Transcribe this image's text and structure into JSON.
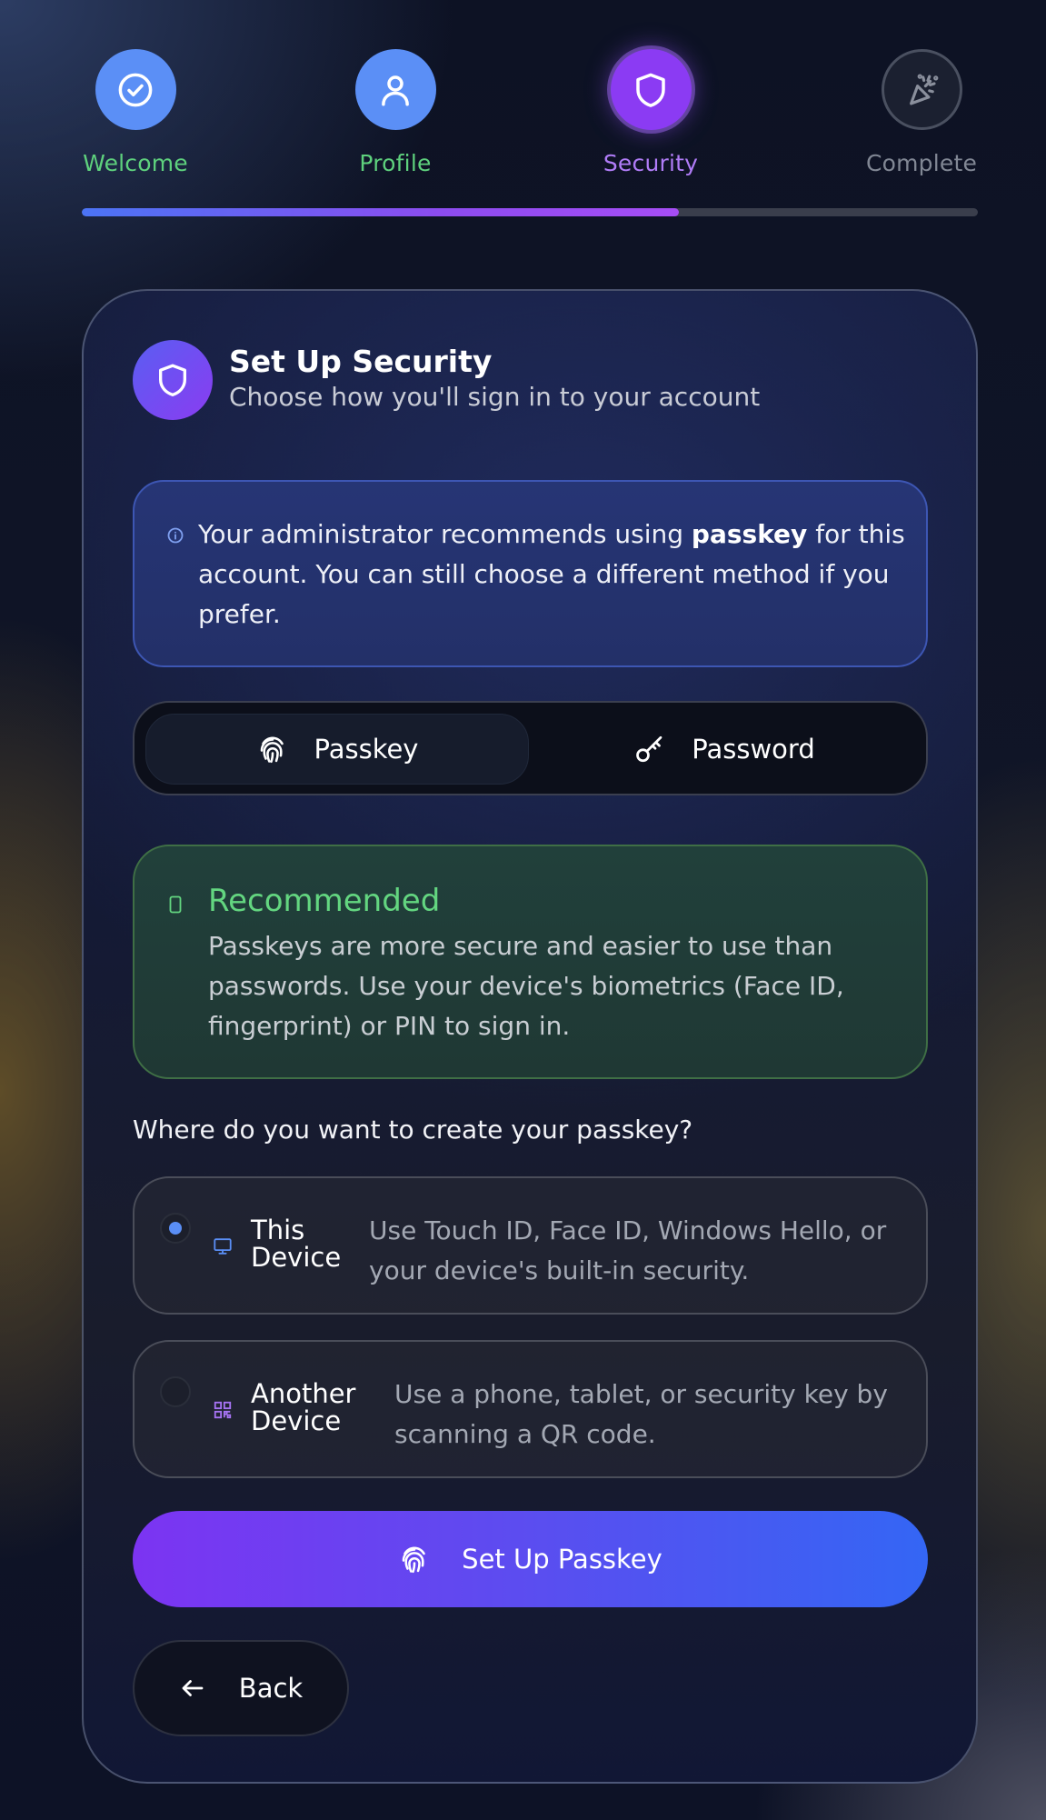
{
  "stepper": {
    "steps": [
      {
        "label": "Welcome",
        "status": "done",
        "icon": "check-circle-icon"
      },
      {
        "label": "Profile",
        "status": "done",
        "icon": "user-icon"
      },
      {
        "label": "Security",
        "status": "active",
        "icon": "shield-icon"
      },
      {
        "label": "Complete",
        "status": "pending",
        "icon": "party-popper-icon"
      }
    ],
    "progress_fraction": 0.6667
  },
  "header": {
    "title": "Set Up Security",
    "subtitle": "Choose how you'll sign in to your account",
    "icon": "shield-icon"
  },
  "info": {
    "icon": "info-icon",
    "text_before": "Your administrator recommends using ",
    "text_bold": "passkey",
    "text_after": " for this account. You can still choose a different method if you prefer."
  },
  "method_toggle": {
    "selected": "Passkey",
    "options": [
      {
        "label": "Passkey",
        "icon": "fingerprint-icon"
      },
      {
        "label": "Password",
        "icon": "key-icon"
      }
    ]
  },
  "recommended": {
    "icon": "smartphone-icon",
    "title": "Recommended",
    "body": "Passkeys are more secure and easier to use than passwords. Use your device's biometrics (Face ID, fingerprint) or PIN to sign in."
  },
  "location": {
    "question": "Where do you want to create your passkey?",
    "options": [
      {
        "title": "This Device",
        "description": "Use Touch ID, Face ID, Windows Hello, or your device's built-in security.",
        "icon": "monitor-icon",
        "selected": true
      },
      {
        "title": "Another Device",
        "description": "Use a phone, tablet, or security key by scanning a QR code.",
        "icon": "qr-code-icon",
        "selected": false
      }
    ]
  },
  "actions": {
    "primary_label": "Set Up Passkey",
    "back_label": "Back"
  },
  "colors": {
    "done_green": "#5ed17d",
    "active_purple": "#8b3bf3",
    "primary_blue": "#5b8ff6",
    "recommended_green": "#63d680"
  }
}
